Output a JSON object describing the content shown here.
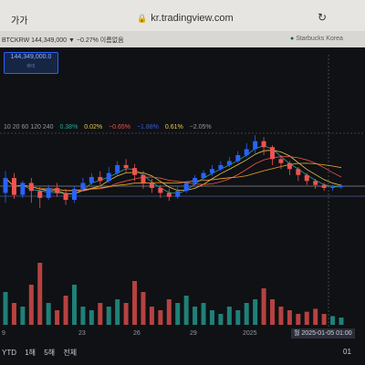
{
  "browser": {
    "aa_label": "가가",
    "url": "kr.tradingview.com",
    "lock_icon": "lock-icon",
    "reload_icon": "reload-icon"
  },
  "tabs": {
    "left": "BTCKRW 144,349,000 ▼ −0.27% 이름없음",
    "right": "Starbucks Korea"
  },
  "price_tag": {
    "value": "144,349,000.0",
    "sub": "바이"
  },
  "indicators": {
    "periods": "10 20 60 120 240",
    "values": [
      {
        "text": "0.38%",
        "color": "#26a69a"
      },
      {
        "text": "0.02%",
        "color": "#e6c84a"
      },
      {
        "text": "−0.65%",
        "color": "#ef5350"
      },
      {
        "text": "−1.88%",
        "color": "#3b5bdb"
      },
      {
        "text": "0.61%",
        "color": "#e6c84a"
      },
      {
        "text": "−2.05%",
        "color": "#9598a1"
      }
    ]
  },
  "x_axis": {
    "ticks": [
      {
        "label": "9"
      },
      {
        "label": "23"
      },
      {
        "label": "26"
      },
      {
        "label": "29"
      },
      {
        "label": "2025"
      }
    ],
    "cursor": "월 2025-01-05  01:00"
  },
  "range_buttons": [
    "YTD",
    "1해",
    "5해",
    "전체"
  ],
  "clock": "01",
  "colors": {
    "up": "#26a69a",
    "down": "#ef5350",
    "up_candle": "#2962ff",
    "background": "#0f1114"
  },
  "chart_data": {
    "type": "candlestick",
    "title": "",
    "xlabel": "",
    "ylabel": "",
    "series": [
      {
        "values": [
          [
            0.4,
            0.55,
            0.3,
            0.62
          ],
          [
            0.55,
            0.38,
            0.34,
            0.6
          ],
          [
            0.38,
            0.5,
            0.35,
            0.52
          ],
          [
            0.5,
            0.42,
            0.3,
            0.55
          ],
          [
            0.42,
            0.35,
            0.25,
            0.46
          ],
          [
            0.35,
            0.45,
            0.33,
            0.48
          ],
          [
            0.45,
            0.4,
            0.36,
            0.5
          ],
          [
            0.4,
            0.33,
            0.28,
            0.44
          ],
          [
            0.33,
            0.44,
            0.3,
            0.47
          ],
          [
            0.44,
            0.5,
            0.42,
            0.55
          ],
          [
            0.5,
            0.56,
            0.48,
            0.6
          ],
          [
            0.56,
            0.52,
            0.48,
            0.62
          ],
          [
            0.52,
            0.6,
            0.5,
            0.66
          ],
          [
            0.6,
            0.68,
            0.58,
            0.72
          ],
          [
            0.68,
            0.65,
            0.6,
            0.74
          ],
          [
            0.65,
            0.58,
            0.52,
            0.69
          ],
          [
            0.58,
            0.5,
            0.44,
            0.62
          ],
          [
            0.5,
            0.45,
            0.4,
            0.54
          ],
          [
            0.45,
            0.4,
            0.35,
            0.48
          ],
          [
            0.4,
            0.36,
            0.32,
            0.44
          ],
          [
            0.36,
            0.42,
            0.34,
            0.46
          ],
          [
            0.42,
            0.5,
            0.4,
            0.52
          ],
          [
            0.5,
            0.55,
            0.48,
            0.58
          ],
          [
            0.55,
            0.6,
            0.52,
            0.63
          ],
          [
            0.6,
            0.64,
            0.57,
            0.68
          ],
          [
            0.64,
            0.68,
            0.62,
            0.72
          ],
          [
            0.68,
            0.72,
            0.66,
            0.76
          ],
          [
            0.72,
            0.78,
            0.7,
            0.82
          ],
          [
            0.78,
            0.84,
            0.76,
            0.9
          ],
          [
            0.84,
            0.92,
            0.8,
            0.98
          ],
          [
            0.92,
            0.86,
            0.78,
            0.96
          ],
          [
            0.86,
            0.74,
            0.68,
            0.88
          ],
          [
            0.74,
            0.7,
            0.64,
            0.78
          ],
          [
            0.7,
            0.64,
            0.58,
            0.72
          ],
          [
            0.64,
            0.58,
            0.52,
            0.66
          ],
          [
            0.58,
            0.52,
            0.48,
            0.6
          ],
          [
            0.52,
            0.48,
            0.44,
            0.54
          ],
          [
            0.48,
            0.45,
            0.42,
            0.5
          ],
          [
            0.45,
            0.46,
            0.42,
            0.48
          ],
          [
            0.46,
            0.47,
            0.44,
            0.49
          ]
        ]
      }
    ],
    "volume": [
      0.45,
      0.3,
      0.25,
      0.55,
      0.85,
      0.3,
      0.2,
      0.4,
      0.55,
      0.25,
      0.2,
      0.3,
      0.25,
      0.35,
      0.3,
      0.6,
      0.45,
      0.25,
      0.2,
      0.35,
      0.3,
      0.4,
      0.25,
      0.3,
      0.2,
      0.15,
      0.25,
      0.2,
      0.3,
      0.35,
      0.5,
      0.35,
      0.25,
      0.2,
      0.15,
      0.18,
      0.22,
      0.15,
      0.12,
      0.1
    ],
    "grid": false
  }
}
